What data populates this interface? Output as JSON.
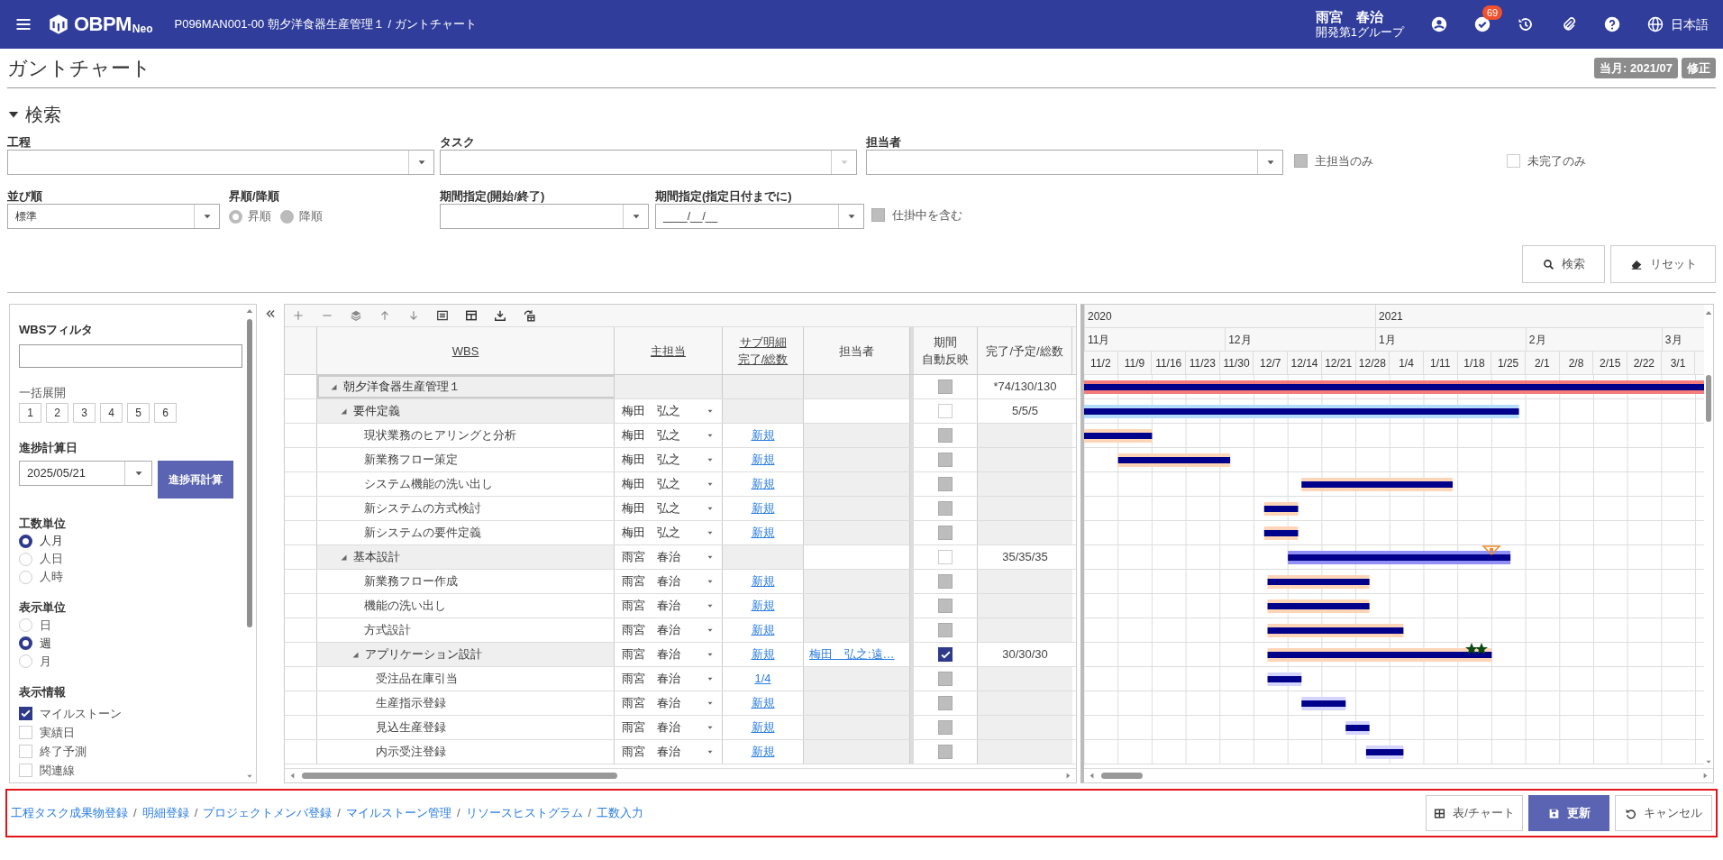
{
  "app_bar": {
    "logo": "OBPM",
    "logo_suffix": "Neo",
    "breadcrumb": "P096MAN001-00 朝夕洋食器生産管理１ / ガントチャート",
    "user": "雨宮　春治",
    "group": "開発第1グループ",
    "badge": "69",
    "language": "日本語"
  },
  "page": {
    "title": "ガントチャート",
    "month": "当月: 2021/07",
    "mode": "修正"
  },
  "search": {
    "title": "検索",
    "expanded": true,
    "process": {
      "label": "工程"
    },
    "task": {
      "label": "タスク",
      "disabled": true
    },
    "assignee": {
      "label": "担当者"
    },
    "main_only": {
      "label": "主担当のみ",
      "checked": false,
      "disabled": true
    },
    "incomplete_only": {
      "label": "未完了のみ",
      "checked": false,
      "disabled": false
    },
    "sort": {
      "label": "並び順",
      "value": "標準"
    },
    "order": {
      "label": "昇順/降順",
      "disabled": true,
      "options": [
        {
          "label": "昇順",
          "selected": true
        },
        {
          "label": "降順",
          "selected": false
        }
      ]
    },
    "period": {
      "label": "期間指定(開始/終了)"
    },
    "until": {
      "label": "期間指定(指定日付までに)",
      "value": "____/__/__"
    },
    "in_progress": {
      "label": "仕掛中を含む",
      "checked": false,
      "disabled": true
    },
    "buttons": [
      {
        "label": "検索",
        "kind": "search"
      },
      {
        "label": "リセット",
        "kind": "reset"
      }
    ]
  },
  "side": {
    "filter": {
      "label": "WBSフィルタ"
    },
    "expand": {
      "label": "一括展開",
      "levels": [
        "1",
        "2",
        "3",
        "4",
        "5",
        "6"
      ]
    },
    "calc": {
      "label": "進捗計算日",
      "value": "2025/05/21",
      "button": "進捗再計算"
    },
    "unit": {
      "label": "工数単位",
      "options": [
        {
          "label": "人月",
          "selected": true
        },
        {
          "label": "人日",
          "selected": false
        },
        {
          "label": "人時",
          "selected": false
        }
      ]
    },
    "display_unit": {
      "label": "表示単位",
      "options": [
        {
          "label": "日",
          "selected": false
        },
        {
          "label": "週",
          "selected": true
        },
        {
          "label": "月",
          "selected": false
        }
      ]
    },
    "info": {
      "label": "表示情報",
      "options": [
        {
          "label": "マイルストーン",
          "checked": true
        },
        {
          "label": "実績日",
          "checked": false
        },
        {
          "label": "終了予測",
          "checked": false
        },
        {
          "label": "関連線",
          "checked": false
        }
      ]
    }
  },
  "table": {
    "columns": [
      {
        "lines": [
          "WBS"
        ],
        "sortable": true
      },
      {
        "lines": [
          "主担当"
        ],
        "sortable": true
      },
      {
        "lines": [
          "サブ明細",
          "完了/総数"
        ],
        "sortable": true
      },
      {
        "lines": [
          "担当者"
        ],
        "sortable": false
      },
      {
        "lines": [
          "期間",
          "自動反映"
        ],
        "sortable": false
      },
      {
        "lines": [
          "完了/予定/総数"
        ],
        "sortable": false
      }
    ],
    "rows": [
      {
        "name": "朝夕洋食器生産管理１",
        "expanded": true,
        "selected": true,
        "auto": {
          "checked": false,
          "disabled": true
        },
        "total": "*74/130/130",
        "color": "#f47c7c",
        "children": [
          {
            "name": "要件定義",
            "expanded": true,
            "selected": false,
            "owner": "梅田　弘之",
            "auto": {
              "checked": false,
              "disabled": false
            },
            "total": "5/5/5",
            "color": "#b3dcff",
            "children": [
              {
                "name": "現状業務のヒアリングと分析",
                "selected": false,
                "owner": "梅田　弘之",
                "sub": "新規",
                "auto": {
                  "checked": false,
                  "disabled": true
                },
                "color": "#ffd5b8"
              },
              {
                "name": "新業務フロー策定",
                "selected": false,
                "owner": "梅田　弘之",
                "sub": "新規",
                "auto": {
                  "checked": false,
                  "disabled": true
                },
                "color": "#ffd5b8"
              },
              {
                "name": "システム機能の洗い出し",
                "selected": false,
                "owner": "梅田　弘之",
                "sub": "新規",
                "auto": {
                  "checked": false,
                  "disabled": true
                },
                "color": "#ffd5b8"
              },
              {
                "name": "新システムの方式検討",
                "selected": false,
                "owner": "梅田　弘之",
                "sub": "新規",
                "auto": {
                  "checked": false,
                  "disabled": true
                },
                "color": "#ffd5b8"
              },
              {
                "name": "新システムの要件定義",
                "selected": false,
                "owner": "梅田　弘之",
                "sub": "新規",
                "auto": {
                  "checked": false,
                  "disabled": true
                },
                "color": "#ffd5b8"
              }
            ]
          },
          {
            "name": "基本設計",
            "expanded": true,
            "selected": false,
            "owner": "雨宮　春治",
            "auto": {
              "checked": false,
              "disabled": false
            },
            "total": "35/35/35",
            "color": "#8f8ff5",
            "marker": {
              "kind": "milestone",
              "at": {
                "level": 0.657
              }
            },
            "children": [
              {
                "name": "新業務フロー作成",
                "selected": false,
                "owner": "雨宮　春治",
                "sub": "新規",
                "auto": {
                  "checked": false,
                  "disabled": true
                },
                "color": "#ffd5b8"
              },
              {
                "name": "機能の洗い出し",
                "selected": false,
                "owner": "雨宮　春治",
                "sub": "新規",
                "auto": {
                  "checked": false,
                  "disabled": true
                },
                "color": "#ffd5b8"
              },
              {
                "name": "方式設計",
                "selected": false,
                "owner": "雨宮　春治",
                "sub": "新規",
                "auto": {
                  "checked": false,
                  "disabled": true
                },
                "color": "#ffd5b8"
              },
              {
                "name": "アプリケーション設計",
                "expanded": true,
                "selected": false,
                "owner": "雨宮　春治",
                "sub": "新規",
                "assignee": "梅田　弘之;遠…",
                "auto": {
                  "checked": true,
                  "disabled": false
                },
                "total": "30/30/30",
                "color": "#ffd5b8",
                "marker": {
                  "kind": "stars",
                  "at": {
                    "level": 0.625
                  }
                },
                "children": [
                  {
                    "name": "受注品在庫引当",
                    "selected": false,
                    "owner": "雨宮　春治",
                    "sub": "1/4",
                    "auto": {
                      "checked": false,
                      "disabled": true
                    },
                    "color": "#d4d4ff"
                  },
                  {
                    "name": "生産指示登録",
                    "selected": false,
                    "owner": "雨宮　春治",
                    "sub": "新規",
                    "auto": {
                      "checked": false,
                      "disabled": true
                    },
                    "color": "#d4d4ff"
                  },
                  {
                    "name": "見込生産登録",
                    "selected": false,
                    "owner": "雨宮　春治",
                    "sub": "新規",
                    "auto": {
                      "checked": false,
                      "disabled": true
                    },
                    "color": "#d4d4ff"
                  },
                  {
                    "name": "内示受注登録",
                    "selected": false,
                    "owner": "雨宮　春治",
                    "sub": "新規",
                    "auto": {
                      "checked": false,
                      "disabled": true
                    },
                    "color": "#d4d4ff"
                  }
                ]
              }
            ]
          }
        ]
      }
    ]
  },
  "timeline": {
    "years": [
      {
        "label": "2020",
        "at": {
          "level": 0
        }
      },
      {
        "label": "2021",
        "at": {
          "level": 0.4696
        }
      }
    ],
    "months": [
      {
        "label": "11月",
        "at": {
          "level": 0
        }
      },
      {
        "label": "12月",
        "at": {
          "level": 0.227
        }
      },
      {
        "label": "1月",
        "at": {
          "level": 0.4696
        }
      },
      {
        "label": "2月",
        "at": {
          "level": 0.712
        }
      },
      {
        "label": "3月",
        "at": {
          "level": 0.9315
        }
      }
    ],
    "weeks": [
      "11/2",
      "11/9",
      "11/16",
      "11/23",
      "11/30",
      "12/7",
      "12/14",
      "12/21",
      "12/28",
      "1/4",
      "1/11",
      "1/18",
      "1/25",
      "2/1",
      "2/8",
      "2/15",
      "2/22",
      "3/1"
    ]
  },
  "footer": {
    "highlighted": true,
    "links": [
      "工程タスク成果物登録",
      "明細登録",
      "プロジェクトメンバ登録",
      "マイルストーン管理",
      "リソースヒストグラム",
      "工数入力"
    ],
    "separators": [
      "/",
      "/",
      "/",
      "/",
      "/"
    ],
    "buttons": [
      {
        "label": "表/チャート",
        "kind": "toggle"
      },
      {
        "label": "更新",
        "kind": "primary"
      },
      {
        "label": "キャンセル",
        "kind": "cancel"
      }
    ]
  }
}
